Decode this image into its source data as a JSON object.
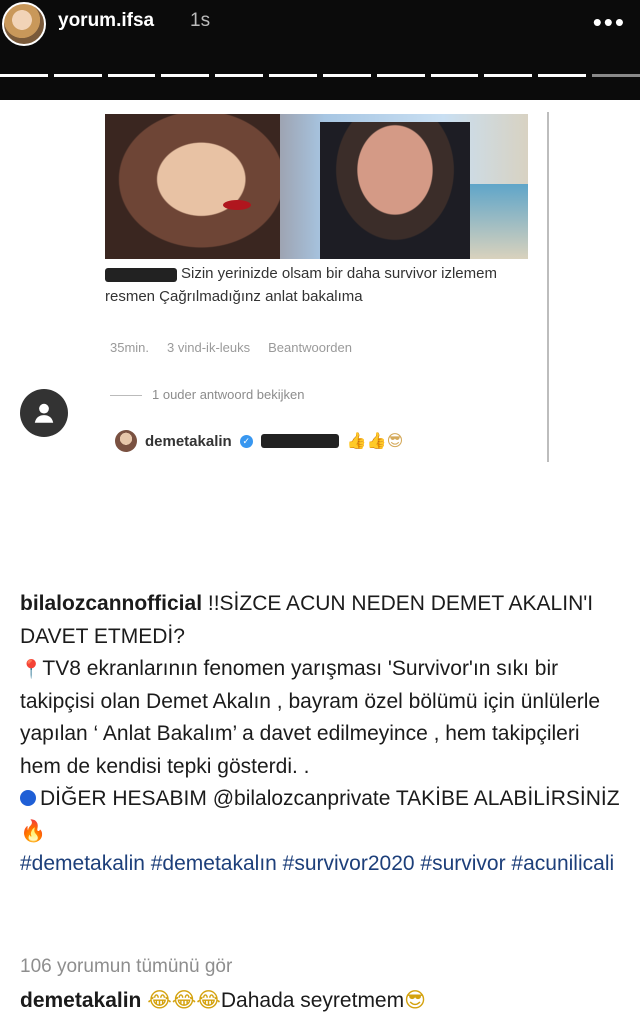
{
  "story": {
    "username": "yorum.ifsa",
    "time_ago": "1s",
    "more_label": "•••",
    "progress_segments_total": 12,
    "progress_segments_done": 11
  },
  "embedded_post": {
    "comment_text": "Sizin yerinizde olsam bir daha survivor izlemem resmen Çağrılmadığınz anlat bakalıma",
    "comment_time": "35min.",
    "comment_likes": "3 vind-ik-leuks",
    "reply_label": "Beantwoorden",
    "view_replies": "1 ouder antwoord bekijken",
    "reply_user": "demetakalin",
    "reply_emojis": "👍👍😎"
  },
  "caption": {
    "owner": "bilalozcannofficial",
    "line1": "!!SİZCE ACUN NEDEN DEMET AKALIN'I DAVET ETMEDİ?",
    "pin_icon": "📍",
    "para1": "TV8 ekranlarının fenomen yarışması 'Survivor'ın sıkı bir takipçisi olan Demet Akalın , bayram özel bölümü için ünlülerle yapılan ‘ Anlat Bakalım’ a davet edilmeyince , hem takipçileri hem de kendisi tepki gösterdi. .",
    "para2": "DİĞER HESABIM @bilalozcanprivate TAKİBE ALABİLİRSİNİZ",
    "fire_icon": "🔥",
    "hashtags": "#demetakalin #demetakalın #survivor2020 #survivor #acunilicali"
  },
  "view_all_comments": "106 yorumun tümünü gör",
  "last_comment": {
    "user": "demetakalin",
    "emojis_before": "😂😂😂",
    "text": "Dahada seyretmem",
    "emoji_after": "😎"
  },
  "colors": {
    "header_bg": "#0b0b0b",
    "verified": "#3897f0",
    "hashtag": "#1d3f7a"
  }
}
